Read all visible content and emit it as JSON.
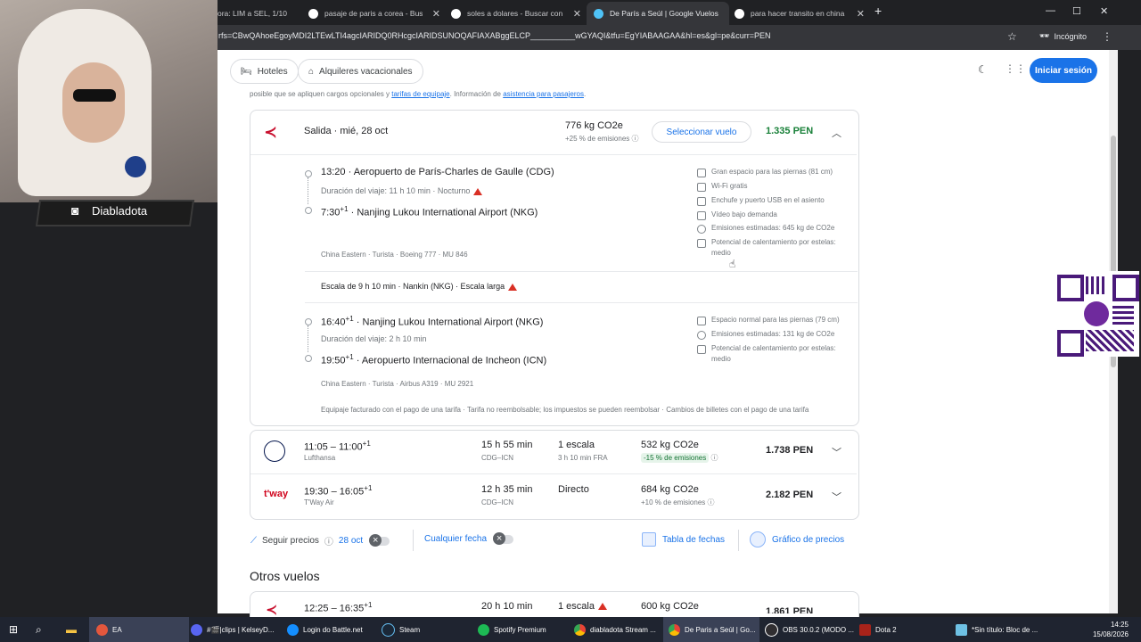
{
  "browser": {
    "tabs": [
      {
        "title": "ora: LIM a SEL, 1/10",
        "active": false
      },
      {
        "title": "pasaje de paris a corea - Buscar",
        "active": false
      },
      {
        "title": "soles a dolares - Buscar con Go",
        "active": false
      },
      {
        "title": "De París a Seúl | Google Vuelos",
        "active": true
      },
      {
        "title": "para hacer transito en china co",
        "active": false
      }
    ],
    "url": "rfs=CBwQAhoeEgoyMDI2LTEwLTI4agcIARIDQ0RHcgcIARIDSUNOQAFIAXABggELCP__________wGYAQI&tfu=EgYIABAAGAA&hl=es&gl=pe&curr=PEN",
    "incognito_label": "Incógnito"
  },
  "topnav": {
    "hotels": "Hoteles",
    "rentals": "Alquileres vacacionales",
    "signin": "Iniciar sesión"
  },
  "notice": {
    "text_before": "posible que se apliquen cargos opcionales y",
    "link1": "tarifas de equipaje",
    "text_mid": ". Información de",
    "link2": "asistencia para pasajeros",
    "text_after": "."
  },
  "expanded_flight": {
    "header_label": "Salida",
    "header_date": "mié, 28 oct",
    "emissions": "776 kg CO2e",
    "emissions_pct": "+25 % de emisiones",
    "select_button": "Seleccionar vuelo",
    "price": "1.335 PEN",
    "seg1": {
      "dep_time": "13:20",
      "dep_airport": "Aeropuerto de París-Charles de Gaulle (CDG)",
      "duration": "Duración del viaje: 11 h 10 min",
      "duration_extra": "Nocturno",
      "arr_time": "7:30",
      "arr_sup": "+1",
      "arr_airport": "Nanjing Lukou International Airport (NKG)",
      "carrier_line": "China Eastern · Turista · Boeing 777 · MU 846",
      "amenities": [
        "Gran espacio para las piernas (81 cm)",
        "Wi-Fi gratis",
        "Enchufe y puerto USB en el asiento",
        "Vídeo bajo demanda",
        "Emisiones estimadas: 645 kg de CO2e",
        "Potencial de calentamiento por estelas: medio"
      ]
    },
    "layover": "Escala de 9 h 10 min · Nankín (NKG) · Escala larga",
    "seg2": {
      "dep_time": "16:40",
      "dep_sup": "+1",
      "dep_airport": "Nanjing Lukou International Airport (NKG)",
      "duration": "Duración del viaje: 2 h 10 min",
      "arr_time": "19:50",
      "arr_sup": "+1",
      "arr_airport": "Aeropuerto Internacional de Incheon (ICN)",
      "carrier_line": "China Eastern · Turista · Airbus A319 · MU 2921",
      "amenities": [
        "Espacio normal para las piernas (79 cm)",
        "Emisiones estimadas: 131 kg de CO2e",
        "Potencial de calentamiento por estelas: medio"
      ]
    },
    "footer": "Equipaje facturado con el pago de una tarifa · Tarifa no reembolsable; los impuestos se pueden reembolsar · Cambios de billetes con el pago de una tarifa"
  },
  "other_results": [
    {
      "times": "11:05 – 11:00",
      "sup": "+1",
      "airline": "Lufthansa",
      "duration": "15 h 55 min",
      "route": "CDG–ICN",
      "stops": "1 escala",
      "stops_detail": "3 h 10 min FRA",
      "emissions": "532 kg CO2e",
      "emissions_pct": "-15 % de emisiones",
      "price": "1.738 PEN"
    },
    {
      "times": "19:30 – 16:05",
      "sup": "+1",
      "airline": "T'Way Air",
      "duration": "12 h 35 min",
      "route": "CDG–ICN",
      "stops": "Directo",
      "stops_detail": "",
      "emissions": "684 kg CO2e",
      "emissions_pct": "+10 % de emisiones",
      "price": "2.182 PEN"
    }
  ],
  "tools": {
    "track_prices": "Seguir precios",
    "date": "28 oct",
    "any_date": "Cualquier fecha",
    "date_grid": "Tabla de fechas",
    "price_graph": "Gráfico de precios"
  },
  "other_flights": {
    "heading": "Otros vuelos",
    "first": {
      "times": "12:25 – 16:35",
      "sup": "+1",
      "duration": "20 h 10 min",
      "stops": "1 escala",
      "emissions": "600 kg CO2e",
      "price": "1.861 PEN"
    }
  },
  "overlay": {
    "streamer_name": "Diabladota"
  },
  "taskbar": {
    "items": [
      "EA",
      "#🎬|clips | KelseyD...",
      "Login do Battle.net",
      "Steam",
      "Spotify Premium",
      "diabladota Stream ...",
      "De Paris a Seúl | Go...",
      "OBS 30.0.2 (MODO ...",
      "Dota 2",
      "*Sin título: Bloc de ..."
    ],
    "time": "14:25",
    "date": "15/08/2026"
  },
  "colors": {
    "accent": "#1a73e8",
    "price_green": "#188038",
    "warning": "#d93025"
  }
}
